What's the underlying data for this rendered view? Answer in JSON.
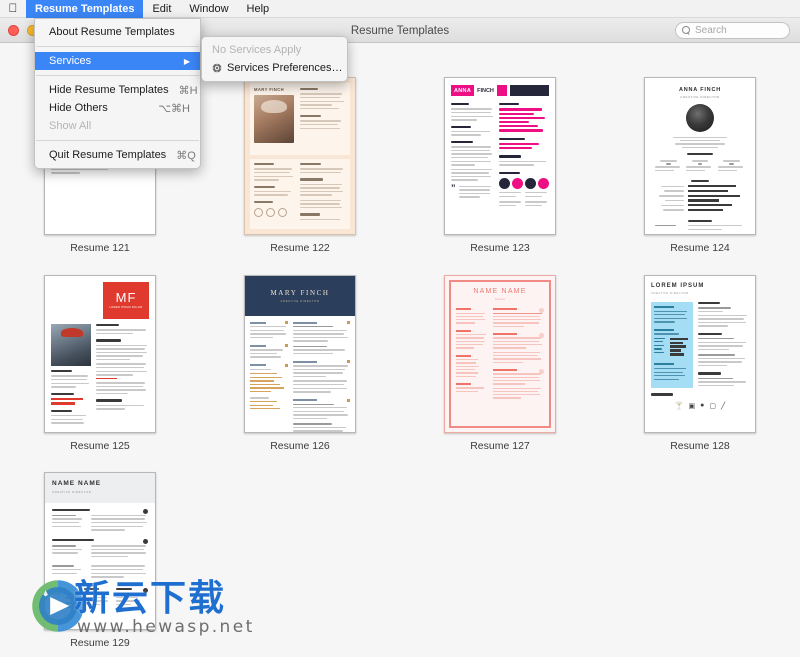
{
  "menubar": {
    "apple_icon": "apple-logo-icon",
    "items": [
      {
        "label": "Resume Templates",
        "active": true
      },
      {
        "label": "Edit",
        "active": false
      },
      {
        "label": "Window",
        "active": false
      },
      {
        "label": "Help",
        "active": false
      }
    ]
  },
  "window": {
    "title": "Resume Templates",
    "traffic_lights": [
      "close-button",
      "minimize-button",
      "maximize-button"
    ],
    "search": {
      "placeholder": "Search",
      "value": "",
      "icon": "search-icon"
    }
  },
  "app_menu": {
    "items": [
      {
        "label": "About Resume Templates",
        "shortcut": "",
        "state": "normal",
        "submenu": false
      },
      {
        "label": "Services",
        "shortcut": "",
        "state": "selected",
        "submenu": true,
        "arrow": "▶"
      },
      {
        "label": "Hide Resume Templates",
        "shortcut": "⌘H",
        "state": "normal",
        "submenu": false
      },
      {
        "label": "Hide Others",
        "shortcut": "⌥⌘H",
        "state": "normal",
        "submenu": false
      },
      {
        "label": "Show All",
        "shortcut": "",
        "state": "disabled",
        "submenu": false
      },
      {
        "label": "Quit Resume Templates",
        "shortcut": "⌘Q",
        "state": "normal",
        "submenu": false
      }
    ]
  },
  "services_submenu": {
    "items": [
      {
        "label": "No Services Apply",
        "state": "disabled",
        "icon": ""
      },
      {
        "label": "Services Preferences…",
        "state": "normal",
        "icon": "gear-icon"
      }
    ]
  },
  "templates": [
    {
      "id": "121",
      "label": "Resume 121",
      "style": "t121",
      "heading": "",
      "subheading": "",
      "accent": "#c4c4c4"
    },
    {
      "id": "122",
      "label": "Resume 122",
      "style": "t122",
      "heading": "MARY FINCH",
      "subheading": "",
      "accent": "#fae6d5"
    },
    {
      "id": "123",
      "label": "Resume 123",
      "style": "t123",
      "heading": "ANNA",
      "subheading": "FINCH",
      "accent": "#ef0f85"
    },
    {
      "id": "124",
      "label": "Resume 124",
      "style": "t124",
      "heading": "ANNA FINCH",
      "subheading": "CREATIVE DIRECTOR",
      "accent": "#3a3a3a"
    },
    {
      "id": "125",
      "label": "Resume 125",
      "style": "t125",
      "heading": "MF",
      "subheading": "LOREM IPSUM DOLOR",
      "accent": "#e03a2f"
    },
    {
      "id": "126",
      "label": "Resume 126",
      "style": "t126",
      "heading": "MARY FINCH",
      "subheading": "CREATIVE DIRECTOR",
      "accent": "#2b3e5c"
    },
    {
      "id": "127",
      "label": "Resume 127",
      "style": "t127",
      "heading": "NAME NAME",
      "subheading": "Resume",
      "accent": "#f08a84"
    },
    {
      "id": "128",
      "label": "Resume 128",
      "style": "t128",
      "heading": "LOREM IPSUM",
      "subheading": "CREATIVE DIRECTOR",
      "accent": "#a5ddf5"
    },
    {
      "id": "129",
      "label": "Resume 129",
      "style": "t129",
      "heading": "NAME NAME",
      "subheading": "CREATIVE DIRECTOR",
      "accent": "#eceef0"
    }
  ],
  "watermark": {
    "text_cn": "新云下载",
    "url": "www.hewasp.net",
    "logo_icon": "download-arrow-logo-icon",
    "color_blue": "#1f6fd0",
    "color_gray": "#6e6e6e"
  },
  "colors": {
    "accent_blue": "#3b86f7",
    "background": "#f7f6f6",
    "titlebar": "#ececec"
  }
}
